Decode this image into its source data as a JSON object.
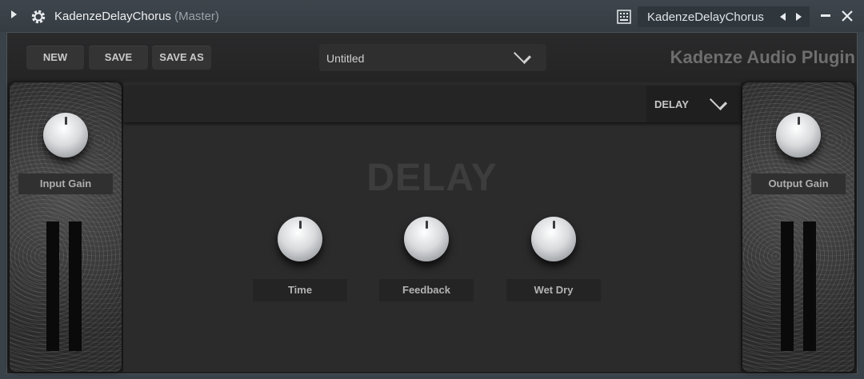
{
  "window": {
    "title": "KadenzeDelayChorus",
    "title_suffix": "(Master)",
    "preset_name": "KadenzeDelayChorus"
  },
  "header": {
    "buttons": {
      "new": "NEW",
      "save": "SAVE",
      "save_as": "SAVE AS"
    },
    "preset_select": "Untitled",
    "brand": "Kadenze Audio Plugin"
  },
  "center": {
    "mode_select": "DELAY",
    "section_title": "DELAY",
    "knobs": {
      "time": "Time",
      "feedback": "Feedback",
      "wet_dry": "Wet Dry"
    }
  },
  "left_panel": {
    "label": "Input Gain"
  },
  "right_panel": {
    "label": "Output Gain"
  }
}
